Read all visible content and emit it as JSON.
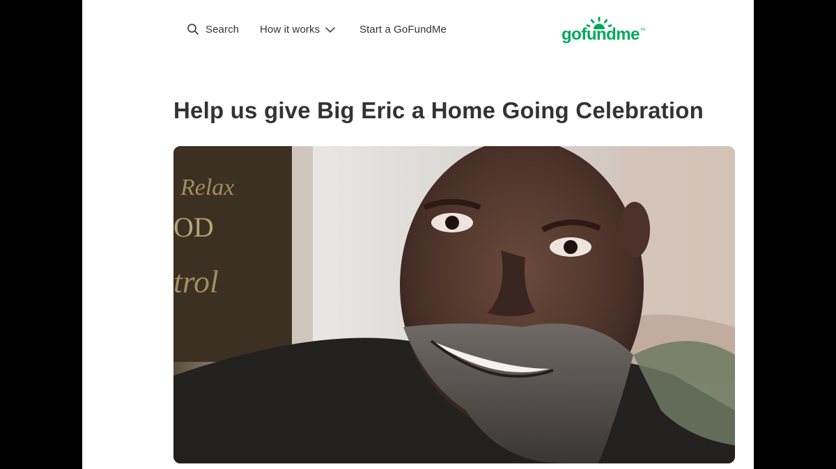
{
  "nav": {
    "search_label": "Search",
    "how_it_works_label": "How it works",
    "start_label": "Start a GoFundMe"
  },
  "logo": {
    "text": "gofundme",
    "trademark": "TM"
  },
  "campaign": {
    "title": "Help us give Big Eric a Home Going Celebration",
    "photo_description_icon": "campaign-photo"
  },
  "colors": {
    "brand_green": "#02a95c",
    "text_dark": "#333333",
    "background_outer": "#000000",
    "page_bg": "#ffffff"
  }
}
